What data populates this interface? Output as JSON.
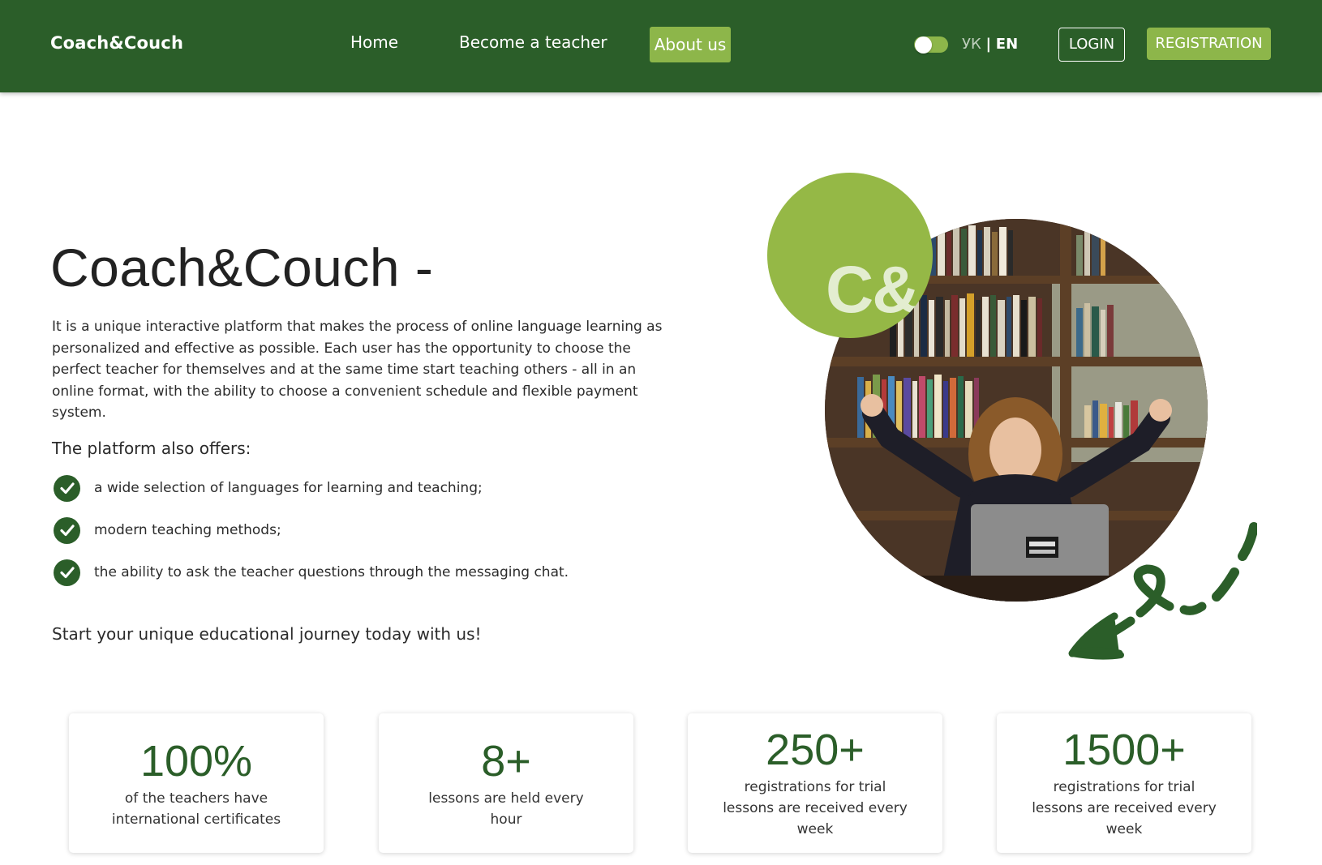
{
  "header": {
    "logo": "Coach&Couch",
    "nav": {
      "home": "Home",
      "become_teacher": "Become a teacher",
      "about": "About us"
    },
    "lang": {
      "uk": "УК",
      "separator": "|",
      "en": "EN",
      "active": "EN"
    },
    "theme_toggle": "toggle-icon",
    "login_label": "LOGIN",
    "registration_label": "REGISTRATION"
  },
  "hero": {
    "title": "Coach&Couch -",
    "description": "It is a unique interactive platform that makes the process of online language learning as personalized and effective as possible. Each user has the opportunity to choose the perfect teacher for themselves and at the same time start teaching others - all in an online format, with the ability to choose a convenient schedule and flexible payment system.",
    "offers_heading": "The platform also offers:",
    "offers": [
      "a wide selection of languages for learning and teaching;",
      "modern teaching methods;",
      "the ability to ask the teacher questions through the messaging chat."
    ],
    "cta": "Start your unique educational journey today with us!",
    "badge_text": "C&"
  },
  "stats": [
    {
      "number": "100%",
      "label": "of the teachers have international certificates"
    },
    {
      "number": "8+",
      "label": "lessons are held every hour"
    },
    {
      "number": "250+",
      "label": "registrations for trial lessons are received every week"
    },
    {
      "number": "1500+",
      "label": "registrations for trial lessons are received every week"
    }
  ],
  "colors": {
    "header_bg": "#2b5e29",
    "accent_green": "#8db64a",
    "dark_green": "#2b5e29",
    "text": "#2b2b2b"
  }
}
